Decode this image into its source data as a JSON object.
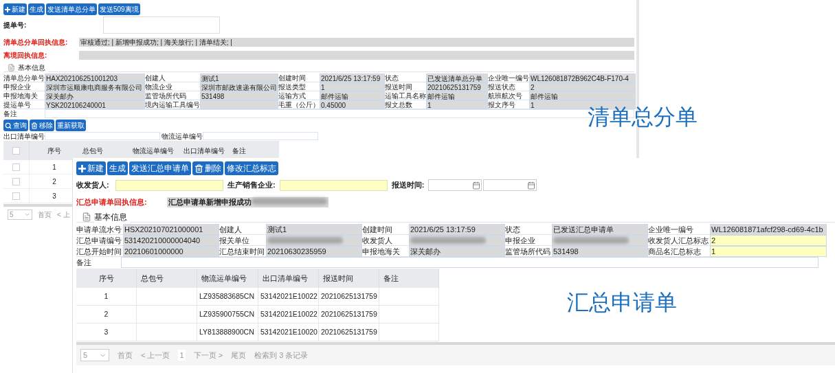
{
  "back_window": {
    "toolbar": [
      {
        "label": "新建",
        "kind": "add"
      },
      {
        "label": "生成",
        "kind": "plain"
      },
      {
        "label": "发送清单总分单",
        "kind": "plain"
      },
      {
        "label": "发送509离境",
        "kind": "plain"
      }
    ],
    "bill_no": {
      "label": "提单号:"
    },
    "receipts": [
      {
        "label": "清单总分单回执信息:",
        "value": "审核通过; | 新增申报成功; | 海关放行; | 清单结关; |"
      },
      {
        "label": "离境回执信息:"
      }
    ],
    "section_title": "基本信息",
    "fields": [
      {
        "label": "清单总分单号",
        "value": "HAX202106251001203"
      },
      {
        "label": "创建人",
        "value": "测试1"
      },
      {
        "label": "创建时间",
        "value": "2021/6/25 13:17:59"
      },
      {
        "label": "状态",
        "value": "已发送清单总分单"
      },
      {
        "label": "企业唯一编号",
        "value": "WL126081872B962C4B-F170-4"
      },
      {
        "label": "申报企业",
        "value": "深圳市运顺康电商服务有限公司"
      },
      {
        "label": "物流企业",
        "value": "深圳市邮政速递有限公司"
      },
      {
        "label": "报送类型",
        "value": "1"
      },
      {
        "label": "报送时间",
        "value": "20210625131759"
      },
      {
        "label": "报送状态",
        "value": "2"
      },
      {
        "label": "申报地海关",
        "value": "深关邮办"
      },
      {
        "label": "监管场所代码",
        "value": "531498"
      },
      {
        "label": "运输方式",
        "value": "邮件运输"
      },
      {
        "label": "运输工具名称",
        "value": "邮件运输"
      },
      {
        "label": "航班航次号",
        "value": "邮件运输"
      },
      {
        "label": "提运单号",
        "value": "YSK202106240001"
      },
      {
        "label": "境内运输工具编号"
      },
      {
        "label": "毛重（公斤）",
        "value": "0.45000"
      },
      {
        "label": "报文总数",
        "value": "1"
      },
      {
        "label": "报文序号",
        "value": "1"
      }
    ],
    "remark_label": "备注",
    "actions": [
      {
        "label": "查询",
        "kind": "search"
      },
      {
        "label": "移除",
        "kind": "delete"
      },
      {
        "label": "重新获取",
        "kind": "plain"
      }
    ],
    "filters": [
      {
        "label": "出口清单编号"
      },
      {
        "label": "物流运单编号"
      }
    ],
    "table": {
      "header_checked": false,
      "columns": [
        "序号",
        "总包号",
        "物流运单编号",
        "出口清单编号",
        "备注"
      ],
      "rows": [
        {
          "checked": false,
          "cells": [
            "1"
          ]
        },
        {
          "checked": false,
          "cells": [
            "2"
          ]
        },
        {
          "checked": false,
          "cells": [
            "3"
          ]
        }
      ]
    },
    "pager": {
      "page_size": "5",
      "first": "首页",
      "prev": "< 上"
    }
  },
  "front_window": {
    "toolbar": [
      {
        "label": "新建",
        "kind": "add"
      },
      {
        "label": "生成",
        "kind": "plain"
      },
      {
        "label": "发送汇总申请单",
        "kind": "plain"
      },
      {
        "label": "删除",
        "kind": "delete"
      },
      {
        "label": "修改汇总标志",
        "kind": "plain"
      }
    ],
    "filters": [
      {
        "label": "收发货人:",
        "kind": "text"
      },
      {
        "label": "生产销售企业:",
        "kind": "text"
      },
      {
        "label": "报送时间:",
        "kind": "date_range"
      }
    ],
    "receipt": {
      "label": "汇总申请单回执信息:",
      "value": "汇总申请单新增申报成功",
      "redacted": true
    },
    "section_title": "基本信息",
    "fields": [
      {
        "label": "申请单流水号",
        "value": "HSX202107021000001",
        "editable": false,
        "redacted": false
      },
      {
        "label": "创建人",
        "value": "测试1",
        "editable": false,
        "redacted": false
      },
      {
        "label": "创建时间",
        "value": "2021/6/25 13:17:59",
        "editable": false,
        "redacted": false
      },
      {
        "label": "状态",
        "value": "已发送汇总申请单",
        "editable": false,
        "redacted": false
      },
      {
        "label": "企业唯一编号",
        "value": "WL126081871afcf298-cd69-4c1b",
        "editable": false,
        "redacted": false
      },
      {
        "label": "汇总申请编号",
        "value": "531420210000004040",
        "editable": false,
        "redacted": false
      },
      {
        "label": "报关单位",
        "editable": false,
        "redacted": true
      },
      {
        "label": "收发货人",
        "editable": false,
        "redacted": true
      },
      {
        "label": "申报企业",
        "editable": false,
        "redacted": true
      },
      {
        "label": "收发货人汇总标志",
        "value": "2",
        "editable": true,
        "redacted": false
      },
      {
        "label": "汇总开始时间",
        "value": "20210601000000",
        "editable": false,
        "redacted": false
      },
      {
        "label": "汇总结束时间",
        "value": "20210630235959",
        "editable": false,
        "redacted": false
      },
      {
        "label": "申报地海关",
        "value": "深关邮办",
        "editable": false,
        "redacted": false
      },
      {
        "label": "监管场所代码",
        "value": "531498",
        "editable": false,
        "redacted": false
      },
      {
        "label": "商品名汇总标志",
        "value": "1",
        "editable": true,
        "redacted": false
      }
    ],
    "remark_label": "备注",
    "table": {
      "columns": [
        "序号",
        "总包号",
        "物流运单编号",
        "出口清单编号",
        "报送时间",
        "备注"
      ],
      "rows": [
        [
          "1",
          "",
          "LZ935883685CN",
          "53142021E10022",
          "20210625131759",
          ""
        ],
        [
          "2",
          "",
          "LZ935900755CN",
          "53142021E10022",
          "20210625131759",
          ""
        ],
        [
          "3",
          "",
          "LY813888900CN",
          "53142021E10020",
          "20210625131759",
          ""
        ]
      ]
    },
    "pager": {
      "page_size": "5",
      "first": "首页",
      "prev": "< 上一页",
      "current": "1",
      "next": "下一页 >",
      "last": "尾页",
      "summary": "检索到 3 条记录"
    }
  },
  "captions": [
    "清单总分单",
    "汇总申请单"
  ]
}
